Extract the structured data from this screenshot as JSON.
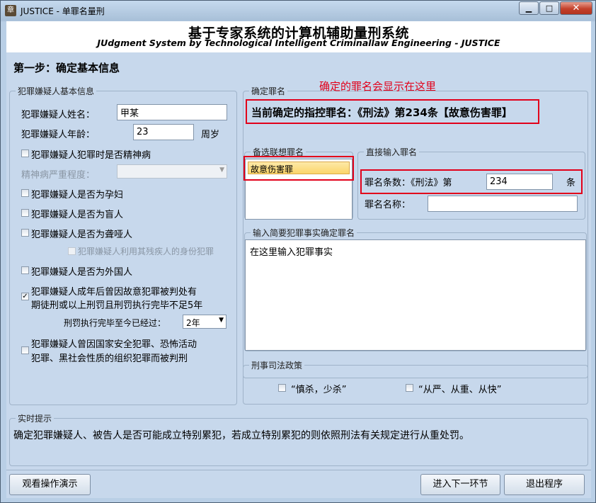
{
  "window": {
    "title": "JUSTICE - 单罪名量刑",
    "icon_glyph": "章",
    "minimize_glyph": "▁",
    "maximize_glyph": "□",
    "close_glyph": "✕"
  },
  "banner": {
    "title": "基于专家系统的计算机辅助量刑系统",
    "subtitle": "JUdgment System by Technological Intelligent Criminallaw Engineering - JUSTICE"
  },
  "step_title": "第一步：确定基本信息",
  "suspect": {
    "group_label": "犯罪嫌疑人基本信息",
    "name_label": "犯罪嫌疑人姓名：",
    "name_value": "甲某",
    "age_label": "犯罪嫌疑人年龄：",
    "age_value": "23",
    "age_unit": "周岁",
    "mental_illness_label": "犯罪嫌疑人犯罪时是否精神病",
    "mental_illness_checked": false,
    "severity_label": "精神病严重程度：",
    "severity_value": "",
    "pregnant_label": "犯罪嫌疑人是否为孕妇",
    "blind_label": "犯罪嫌疑人是否为盲人",
    "deaf_mute_label": "犯罪嫌疑人是否为聋哑人",
    "disability_identity_label": "犯罪嫌疑人利用其残疾人的身份犯罪",
    "foreigner_label": "犯罪嫌疑人是否为外国人",
    "recidivist_label_line1": "犯罪嫌疑人成年后曾因故意犯罪被判处有",
    "recidivist_label_line2": "期徒刑或以上刑罚且刑罚执行完毕不足5年",
    "recidivist_checked": true,
    "check_mark": "✓",
    "elapsed_label": "刑罚执行完毕至今已经过：",
    "elapsed_value": "2年",
    "special_crime_label_line1": "犯罪嫌疑人曾因国家安全犯罪、恐怖活动",
    "special_crime_label_line2": "犯罪、黑社会性质的组织犯罪而被判刑"
  },
  "crime": {
    "group_label": "确定罪名",
    "annotation": "确定的罪名会显示在这里",
    "current_crime": "当前确定的指控罪名：《刑法》第234条【故意伤害罪】",
    "candidates_label": "备选联想罪名",
    "candidates": [
      "故意伤害罪"
    ],
    "direct_input_label": "直接输入罪名",
    "article_prefix": "罪名条数：《刑法》第",
    "article_value": "234",
    "article_suffix": "条",
    "crime_name_label": "罪名名称：",
    "crime_name_value": "",
    "facts_label": "输入简要犯罪事实确定罪名",
    "facts_value": "在这里输入犯罪事实"
  },
  "policy": {
    "group_label": "刑事司法政策",
    "option1": "“慎杀，少杀”",
    "option2": "“从严、从重、从快”"
  },
  "hint": {
    "group_label": "实时提示",
    "text": "确定犯罪嫌疑人、被告人是否可能成立特别累犯，若成立特别累犯的则依照刑法有关规定进行从重处罚。"
  },
  "buttons": {
    "demo": "观看操作演示",
    "next": "进入下一环节",
    "exit": "退出程序"
  },
  "colors": {
    "highlight_red": "#e2001a",
    "selection_yellow": "#fbd56a"
  }
}
